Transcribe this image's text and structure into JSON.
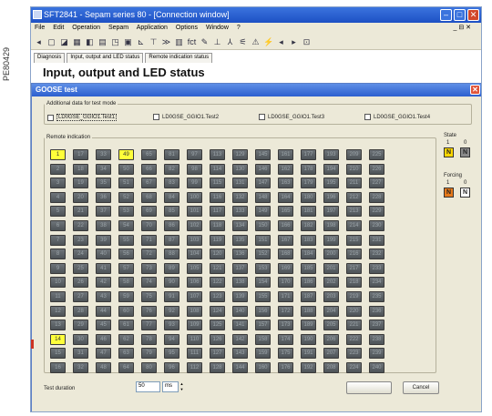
{
  "side_label": "PE80429",
  "window": {
    "title": "SFT2841 - Sepam series 80 - [Connection window]",
    "minimize": "–",
    "maximize": "□",
    "close": "✕"
  },
  "menu": {
    "items": [
      "File",
      "Edit",
      "Operation",
      "Sepam",
      "Application",
      "Options",
      "Window",
      "?"
    ],
    "right": "_ ⊟ ✕"
  },
  "toolbar": {
    "icons": [
      "◂",
      "▢",
      "◪",
      "▦",
      "◧",
      "▤",
      "◳",
      "▣",
      "⊾",
      "⊤",
      "≫",
      "▥",
      "fct",
      "✎",
      "⊥",
      "⅄",
      "⚟",
      "⚠",
      "⚡",
      "◂",
      "▸",
      "⊡"
    ]
  },
  "tabs": [
    "Diagnosis",
    "Input, output and LED status",
    "Remote indication status"
  ],
  "heading": "Input, output and LED status",
  "dialog": {
    "title": "GOOSE test",
    "close": "✕",
    "additional_legend": "Additional data for test mode",
    "checkboxes": [
      "LD0GSE_GGIO1.Test1",
      "LD0GSE_GGIO1.Test2",
      "LD0GSE_GGIO1.Test3",
      "LD0GSE_GGIO1.Test4"
    ],
    "remote_legend": "Remote indication",
    "highlighted": [
      1,
      14,
      49
    ],
    "state": {
      "label": "State",
      "one": "1",
      "zero": "0",
      "on": "N",
      "off": "N"
    },
    "forcing": {
      "label": "Forcing",
      "one": "1",
      "zero": "0",
      "on": "N",
      "off": "N"
    },
    "duration_label": "Test duration",
    "duration_value": "50",
    "duration_unit": "ms",
    "ok_label": "",
    "cancel_label": "Cancel"
  }
}
